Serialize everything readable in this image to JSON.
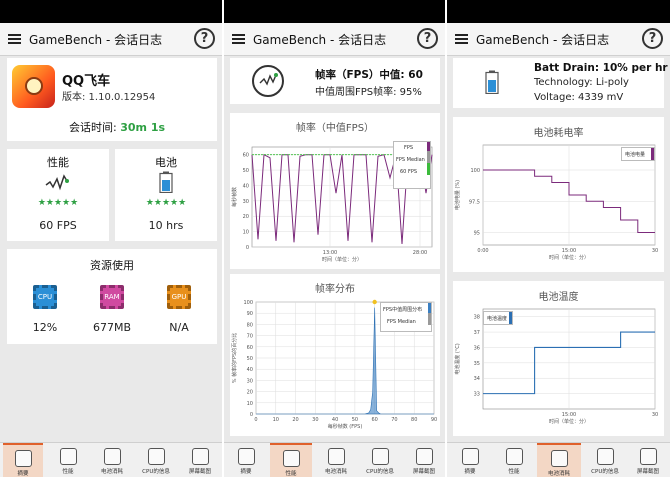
{
  "app": {
    "title": "GameBench - 会话日志",
    "help": "?"
  },
  "tabs": [
    {
      "label": "摘要",
      "icon": "summary-icon"
    },
    {
      "label": "性能",
      "icon": "performance-icon"
    },
    {
      "label": "电池消耗",
      "icon": "battery-icon"
    },
    {
      "label": "CPU的信息",
      "icon": "cpu-icon"
    },
    {
      "label": "屏幕截图",
      "icon": "screenshot-icon"
    }
  ],
  "summary": {
    "game_name": "QQ飞车",
    "version": "版本: 1.10.0.12954",
    "session_label": "会话时间:",
    "session_value": "30m 1s",
    "performance": {
      "title": "性能",
      "value": "60 FPS",
      "stars": "★★★★★"
    },
    "battery": {
      "title": "电池",
      "value": "10 hrs",
      "stars": "★★★★★"
    },
    "resources": {
      "title": "资源使用",
      "items": [
        {
          "chip": "CPU",
          "value": "12%",
          "color": "#2b8fd6"
        },
        {
          "chip": "RAM",
          "value": "677MB",
          "color": "#d04aa0"
        },
        {
          "chip": "GPU",
          "value": "N/A",
          "color": "#e8901c"
        }
      ]
    }
  },
  "performance": {
    "header_title": "帧率（FPS）中值: 60",
    "header_sub": "中值周围FPS帧率: 95%",
    "chart1": {
      "title": "帧率（中值FPS）",
      "ylabel": "每秒帧数",
      "xlabel": "时间（单位：分）",
      "xticks": [
        "13:00",
        "28:00"
      ],
      "yticks": [
        "0",
        "10",
        "20",
        "30",
        "40",
        "50",
        "60"
      ],
      "legend": [
        "FPS",
        "FPS Median",
        "60 FPS"
      ]
    },
    "chart2": {
      "title": "帧率分布",
      "ylabel": "% 帧率的FPS的百分比",
      "xlabel": "每秒帧数 (FPS)",
      "xticks": [
        "0",
        "10",
        "20",
        "30",
        "40",
        "50",
        "60",
        "70",
        "80",
        "90"
      ],
      "yticks": [
        "0",
        "10",
        "20",
        "30",
        "40",
        "50",
        "60",
        "70",
        "80",
        "90",
        "100"
      ],
      "legend": [
        "FPS中值周围分布",
        "FPS Median"
      ]
    }
  },
  "battery": {
    "header_title": "Batt Drain: 10% per hr",
    "header_tech": "Technology: Li-poly",
    "header_voltage": "Voltage: 4339 mV",
    "chart1": {
      "title": "电池耗电率",
      "ylabel": "电池电量 (%)",
      "xlabel": "时间（单位：分）",
      "xticks": [
        "0:00",
        "15:00",
        "30"
      ],
      "yticks": [
        "95",
        "97.5",
        "100"
      ],
      "legend": [
        "电池电量"
      ]
    },
    "chart2": {
      "title": "电池温度",
      "ylabel": "电池温度 (°C)",
      "xlabel": "时间（单位：分）",
      "xticks": [
        "15:00",
        "30"
      ],
      "yticks": [
        "33",
        "34",
        "35",
        "36",
        "37",
        "38"
      ],
      "legend": [
        "电池温度"
      ]
    }
  },
  "chart_data": [
    {
      "type": "line",
      "title": "帧率（中值FPS）",
      "xlabel": "时间（单位：分）",
      "ylabel": "每秒帧数",
      "ylim": [
        0,
        65
      ],
      "series": [
        {
          "name": "FPS",
          "x": [
            0,
            1,
            2,
            3,
            4,
            5,
            6,
            7,
            8,
            9,
            10,
            11,
            12,
            13,
            14,
            15,
            16,
            17,
            18,
            19,
            20,
            21,
            22,
            23,
            24,
            25,
            26,
            27,
            28,
            29,
            30
          ],
          "values": [
            60,
            5,
            60,
            58,
            4,
            60,
            60,
            3,
            59,
            60,
            60,
            8,
            60,
            60,
            35,
            60,
            4,
            60,
            60,
            60,
            3,
            59,
            60,
            45,
            60,
            2,
            60,
            60,
            60,
            35,
            60
          ]
        },
        {
          "name": "FPS Median",
          "x": [
            0,
            30
          ],
          "values": [
            60,
            60
          ]
        },
        {
          "name": "60 FPS",
          "x": [
            0,
            30
          ],
          "values": [
            60,
            60
          ]
        }
      ]
    },
    {
      "type": "area",
      "title": "帧率分布",
      "xlabel": "每秒帧数 (FPS)",
      "ylabel": "% 帧率的FPS的百分比",
      "ylim": [
        0,
        100
      ],
      "x": [
        0,
        55,
        57,
        58,
        59,
        60,
        61,
        62,
        63,
        90
      ],
      "values": [
        0,
        0,
        1,
        4,
        20,
        95,
        3,
        1,
        0,
        0
      ]
    },
    {
      "type": "line",
      "title": "电池耗电率",
      "xlabel": "时间（单位：分）",
      "ylabel": "电池电量 (%)",
      "ylim": [
        94,
        102
      ],
      "x": [
        0,
        3,
        3,
        6,
        6,
        9,
        9,
        12,
        12,
        15,
        15,
        18,
        18,
        21,
        21,
        24,
        24,
        27,
        27,
        30
      ],
      "values": [
        100,
        100,
        100,
        100,
        100,
        100,
        99.5,
        99.5,
        99,
        99,
        98,
        98,
        97.5,
        97.5,
        97,
        97,
        96,
        96,
        95,
        95
      ]
    },
    {
      "type": "line",
      "title": "电池温度",
      "xlabel": "时间（单位：分）",
      "ylabel": "电池温度 (°C)",
      "ylim": [
        32,
        38.5
      ],
      "x": [
        0,
        8,
        8,
        9,
        9,
        14,
        14,
        20,
        20,
        24,
        24,
        30
      ],
      "values": [
        33,
        33,
        33,
        33,
        36,
        36,
        36,
        36,
        36,
        36,
        37,
        37
      ]
    }
  ]
}
